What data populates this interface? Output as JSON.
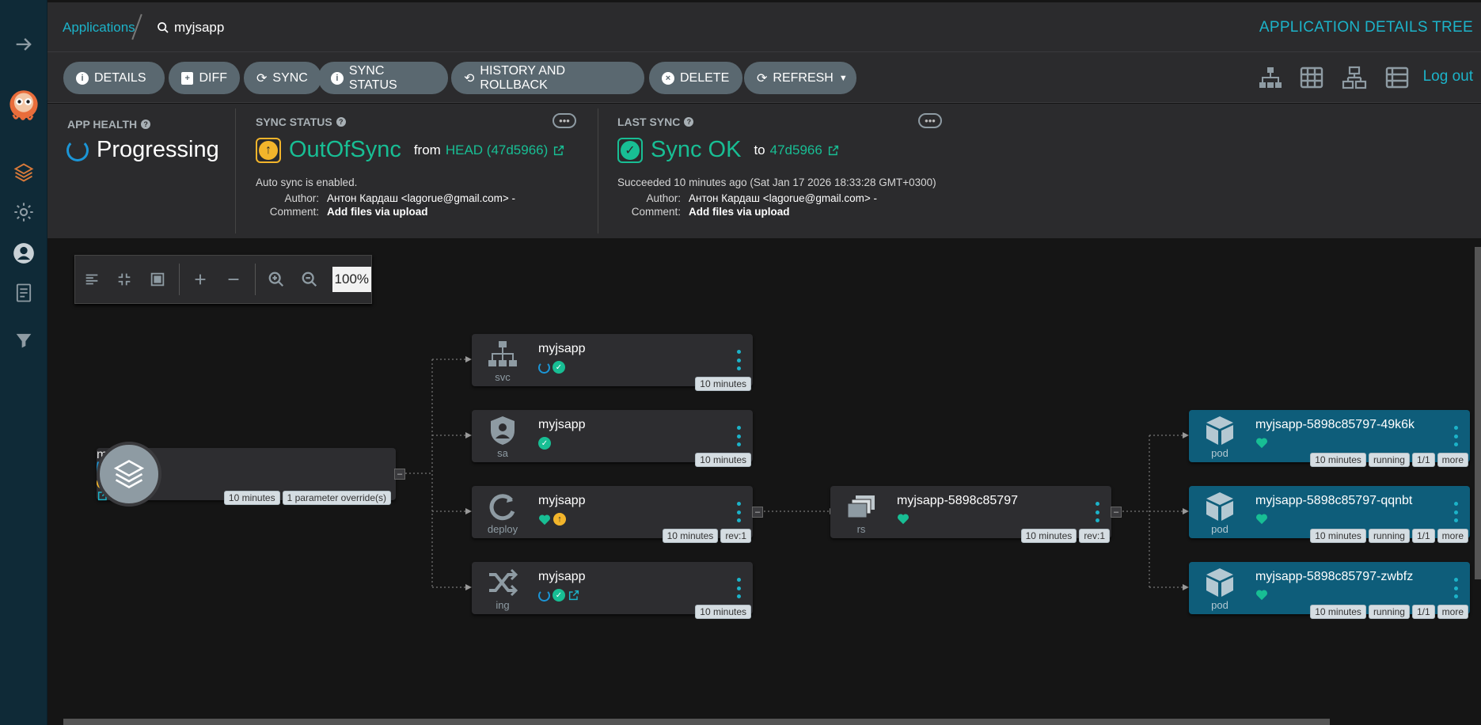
{
  "header": {
    "breadcrumb_root": "Applications",
    "current_app": "myjsapp",
    "page_title": "APPLICATION DETAILS TREE"
  },
  "toolbar": {
    "buttons": [
      "DETAILS",
      "DIFF",
      "SYNC",
      "SYNC STATUS",
      "HISTORY AND ROLLBACK",
      "DELETE",
      "REFRESH"
    ],
    "logout": "Log out"
  },
  "status": {
    "app_health_label": "APP HEALTH",
    "app_health_value": "Progressing",
    "sync_status_label": "SYNC STATUS",
    "sync_status_value": "OutOfSync",
    "sync_from": "from",
    "sync_revision": "HEAD (47d5966)",
    "auto_sync": "Auto sync is enabled.",
    "author_key": "Author:",
    "author_value": "Антон Кардаш <lagorue@gmail.com> -",
    "comment_key": "Comment:",
    "comment_value": "Add files via upload",
    "last_sync_label": "LAST SYNC",
    "last_sync_value": "Sync OK",
    "last_sync_to": "to",
    "last_sync_revision": "47d5966",
    "last_sync_detail": "Succeeded 10 minutes ago (Sat Jan 17 2026 18:33:28 GMT+0300)",
    "last_author_value": "Антон Кардаш <lagorue@gmail.com> -",
    "last_comment_value": "Add files via upload"
  },
  "graph": {
    "zoom": "100%",
    "app": {
      "name": "myjsapp",
      "tags": [
        "10 minutes",
        "1 parameter override(s)"
      ]
    },
    "nodes": [
      {
        "name": "myjsapp",
        "kind": "svc",
        "tags": [
          "10 minutes"
        ]
      },
      {
        "name": "myjsapp",
        "kind": "sa",
        "tags": [
          "10 minutes"
        ]
      },
      {
        "name": "myjsapp",
        "kind": "deploy",
        "tags": [
          "10 minutes",
          "rev:1"
        ]
      },
      {
        "name": "myjsapp",
        "kind": "ing",
        "tags": [
          "10 minutes"
        ]
      },
      {
        "name": "myjsapp-5898c85797",
        "kind": "rs",
        "tags": [
          "10 minutes",
          "rev:1"
        ]
      },
      {
        "name": "myjsapp-5898c85797-49k6k",
        "kind": "pod",
        "tags": [
          "10 minutes",
          "running",
          "1/1",
          "more"
        ]
      },
      {
        "name": "myjsapp-5898c85797-qqnbt",
        "kind": "pod",
        "tags": [
          "10 minutes",
          "running",
          "1/1",
          "more"
        ]
      },
      {
        "name": "myjsapp-5898c85797-zwbfz",
        "kind": "pod",
        "tags": [
          "10 minutes",
          "running",
          "1/1",
          "more"
        ]
      }
    ]
  }
}
